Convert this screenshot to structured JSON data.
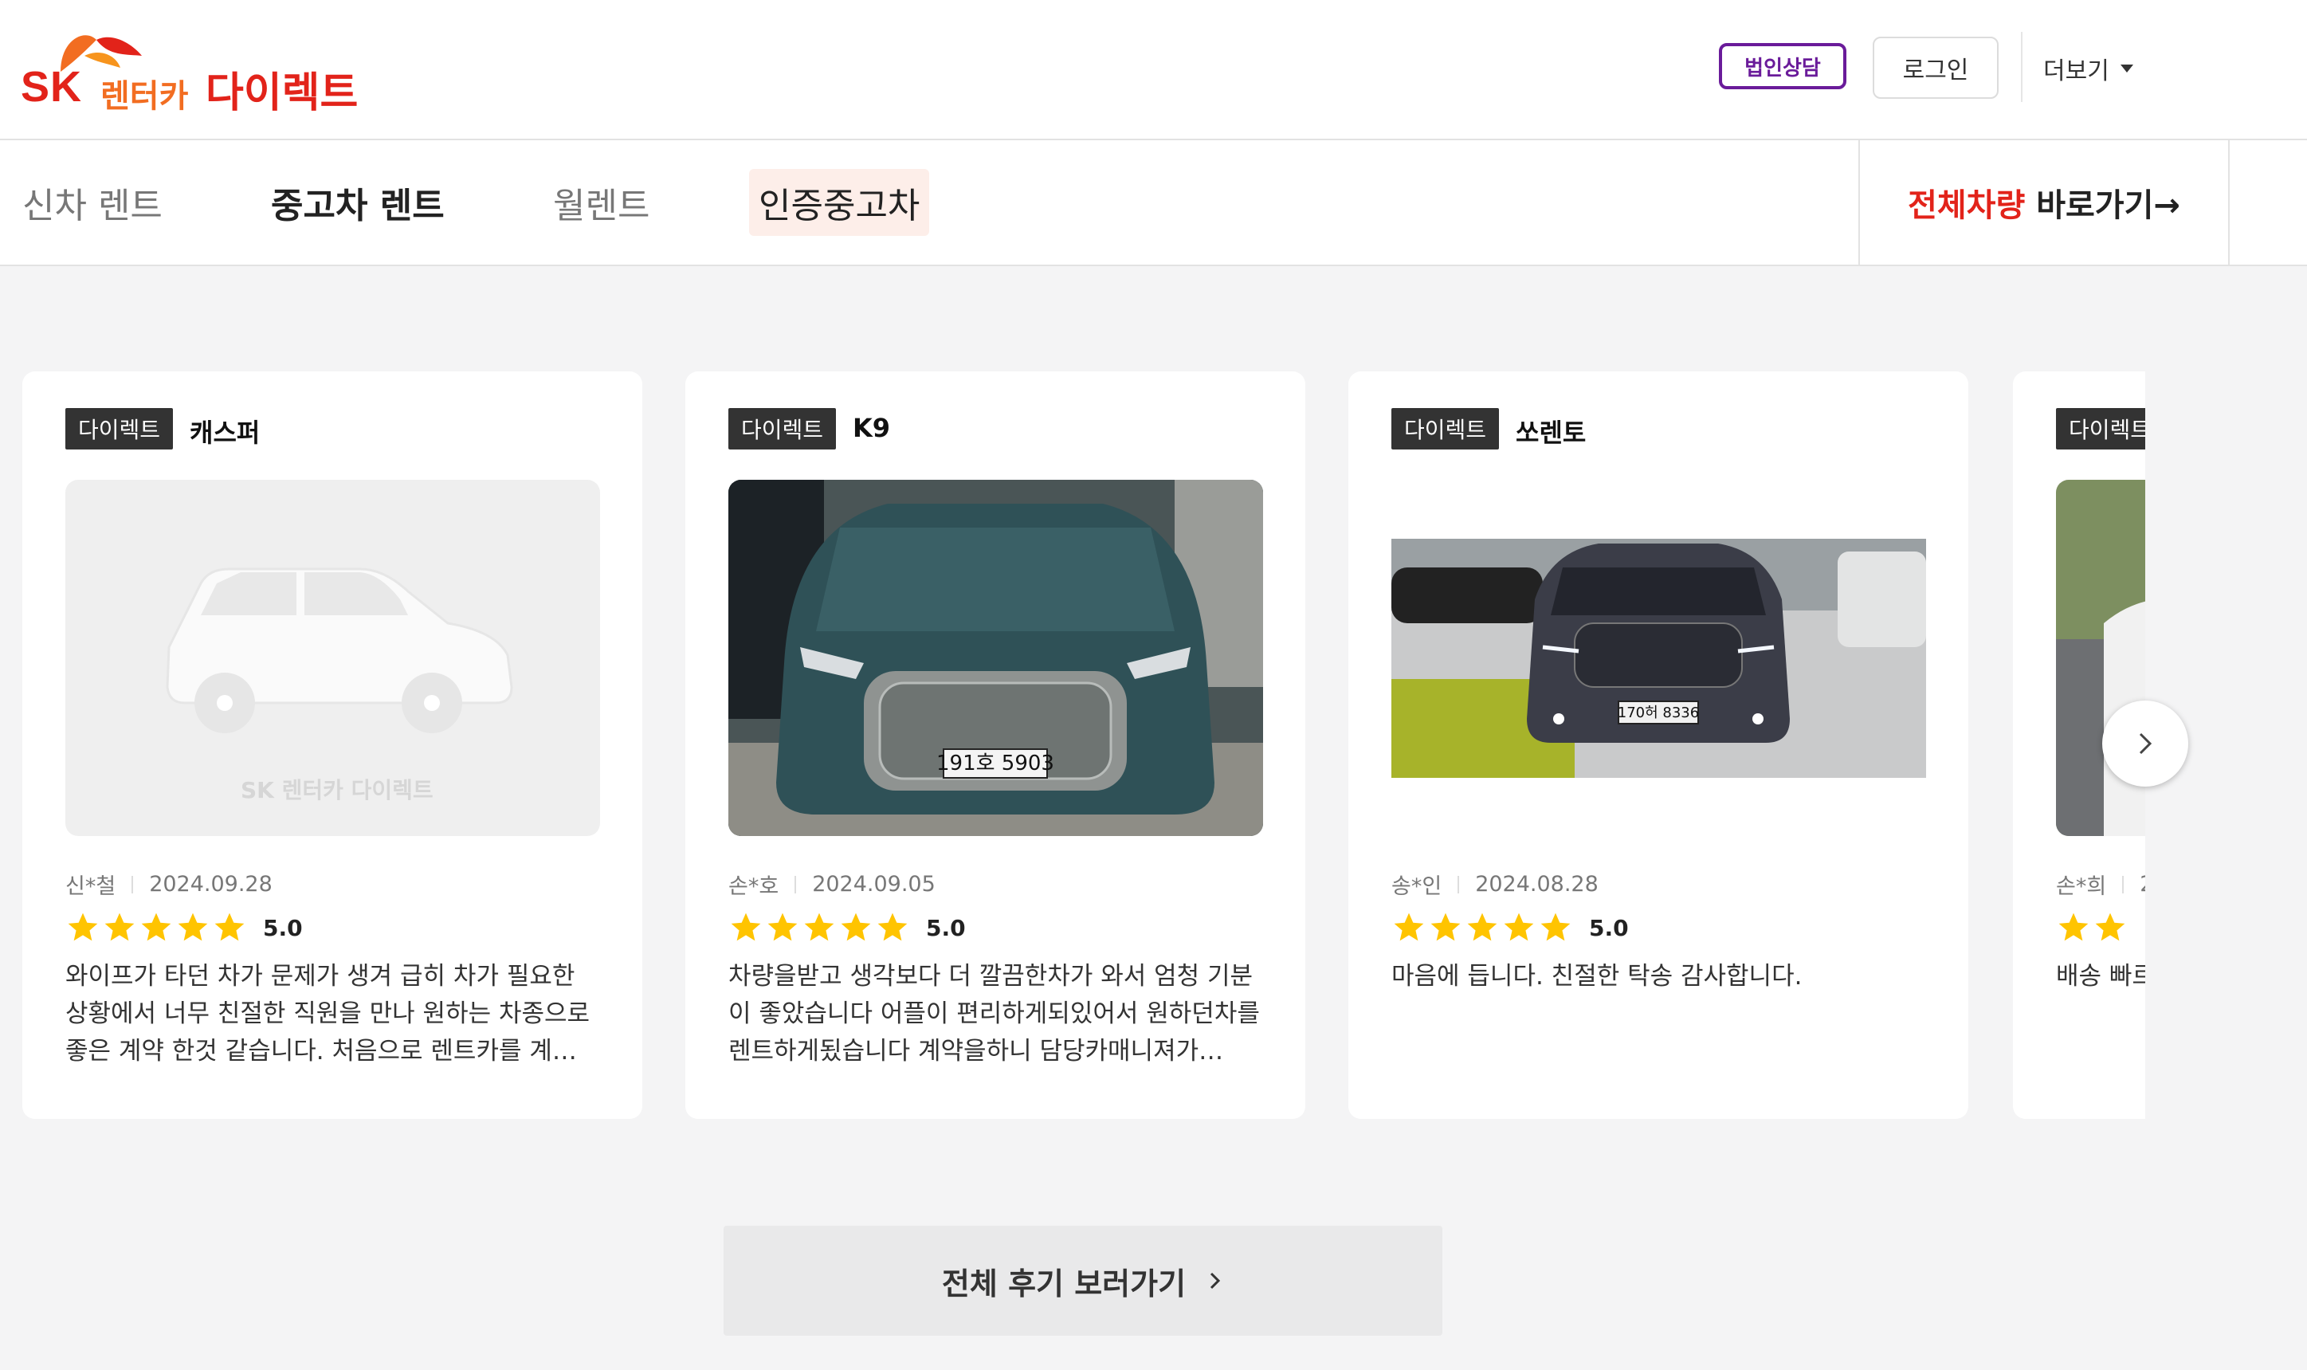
{
  "brand": {
    "sk": "SK",
    "rent": "렌터카",
    "direct": "다이렉트"
  },
  "header": {
    "corp_button": "법인상담",
    "login_button": "로그인",
    "more_label": "더보기"
  },
  "nav": {
    "items": [
      {
        "label": "신차 렌트"
      },
      {
        "label": "중고차 렌트",
        "active": true
      },
      {
        "label": "월렌트"
      },
      {
        "label": "인증중고차"
      }
    ],
    "all_cars_red": "전체차량",
    "all_cars_rest": " 바로가기→"
  },
  "reviews": [
    {
      "tag": "다이렉트",
      "model": "캐스퍼",
      "author": "신*철",
      "date": "2024.09.28",
      "rating": 5,
      "score": "5.0",
      "text": "와이프가 타던 차가 문제가 생겨 급히 차가 필요한 상황에서 너무 친절한 직원을 만나 원하는 차종으로 좋은 계약 한것 같습니다. 처음으로 렌트카를 계…",
      "watermark": "SK 렌터카 다이렉트"
    },
    {
      "tag": "다이렉트",
      "model": "K9",
      "author": "손*호",
      "date": "2024.09.05",
      "rating": 5,
      "score": "5.0",
      "text": "차량을받고 생각보다 더 깔끔한차가 와서 엄청 기분이 좋았습니다 어플이 편리하게되있어서 원하던차를 렌트하게됬습니다 계약을하니 담당카매니져가…",
      "plate": "191호 5903"
    },
    {
      "tag": "다이렉트",
      "model": "쏘렌토",
      "author": "송*인",
      "date": "2024.08.28",
      "rating": 5,
      "score": "5.0",
      "text": "마음에 듭니다. 친절한 탁송 감사합니다.",
      "plate": "170허 8336"
    },
    {
      "tag": "다이렉트",
      "model": "",
      "author": "손*희",
      "date": "2",
      "rating": 2,
      "score": "",
      "text": "배송 빠르니다. 감사"
    }
  ],
  "footer": {
    "all_reviews_button": "전체 후기 보러가기"
  },
  "colors": {
    "brand_red": "#e2231a",
    "brand_orange": "#f26d21",
    "corp_purple": "#6a1b9a",
    "star": "#ffc400"
  }
}
